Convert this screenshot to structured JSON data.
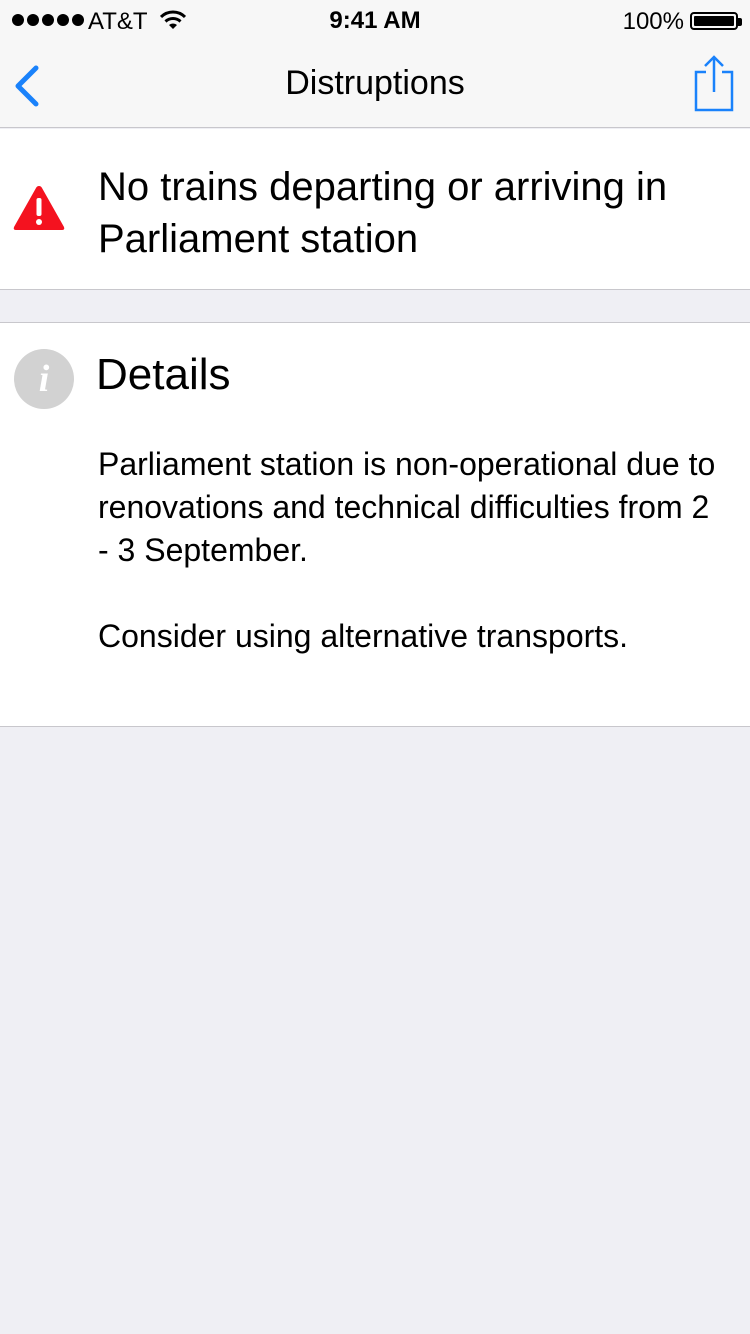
{
  "status_bar": {
    "carrier": "AT&T",
    "time": "9:41 AM",
    "battery": "100%",
    "signal_icon": "signal-dots-icon",
    "wifi_icon": "wifi-icon",
    "battery_icon": "battery-icon"
  },
  "nav": {
    "title": "Distruptions",
    "back_icon": "chevron-left-icon",
    "share_icon": "share-icon",
    "accent_color": "#1a82fb"
  },
  "alert": {
    "icon": "warning-triangle-icon",
    "icon_color": "#f4121f",
    "text": "No trains departing or arriving in Parliament station"
  },
  "details": {
    "icon": "info-icon",
    "title": "Details",
    "paragraph1": "Parliament station is non-operational due to renovations and technical difficulties from 2 - 3 September.",
    "paragraph2": "Consider using alternative transports."
  }
}
